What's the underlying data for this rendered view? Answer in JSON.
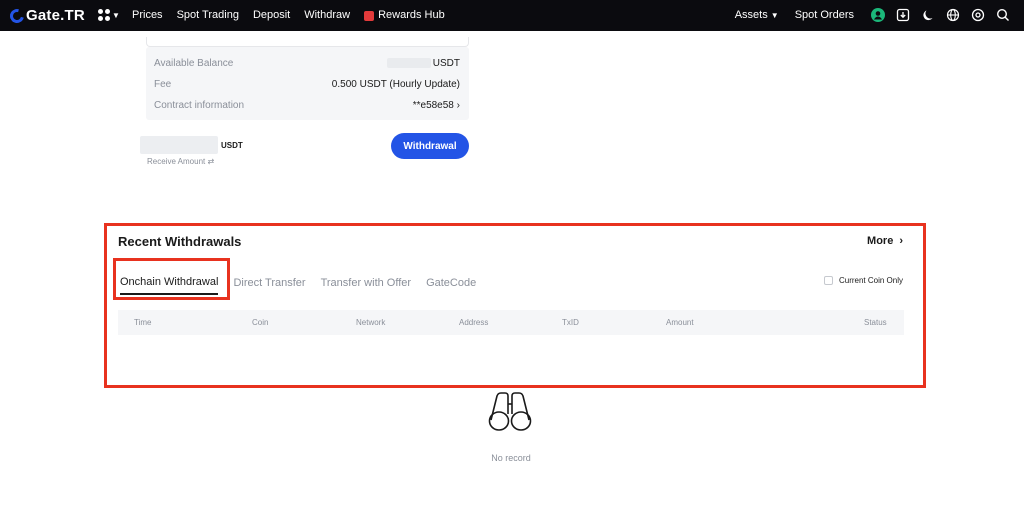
{
  "brand": {
    "logo_text": "Gate.TR",
    "accent": "#2354e6",
    "highlight": "#e8321f"
  },
  "nav": {
    "links": [
      "Prices",
      "Spot Trading",
      "Deposit",
      "Withdraw"
    ],
    "rewards": "Rewards Hub",
    "assets": "Assets",
    "spot_orders": "Spot Orders",
    "icons": [
      "user-avatar-icon",
      "download-icon",
      "moon-icon",
      "globe-icon",
      "settings-icon",
      "search-icon"
    ]
  },
  "form": {
    "available_balance_label": "Available Balance",
    "available_balance_unit": "USDT",
    "fee_label": "Fee",
    "fee_value": "0.500 USDT (Hourly Update)",
    "contract_label": "Contract information",
    "contract_value": "**e58e58",
    "amount_unit": "USDT",
    "receive_amount_label": "Receive Amount ⇄",
    "withdraw_button": "Withdrawal"
  },
  "recent": {
    "title": "Recent Withdrawals",
    "more": "More",
    "tabs": [
      "Onchain Withdrawal",
      "Direct Transfer",
      "Transfer with Offer",
      "GateCode"
    ],
    "active_tab": "Onchain Withdrawal",
    "current_coin_only": "Current Coin Only",
    "columns": [
      "Time",
      "Coin",
      "Network",
      "Address",
      "TxID",
      "Amount",
      "Status"
    ],
    "empty_text": "No record"
  }
}
